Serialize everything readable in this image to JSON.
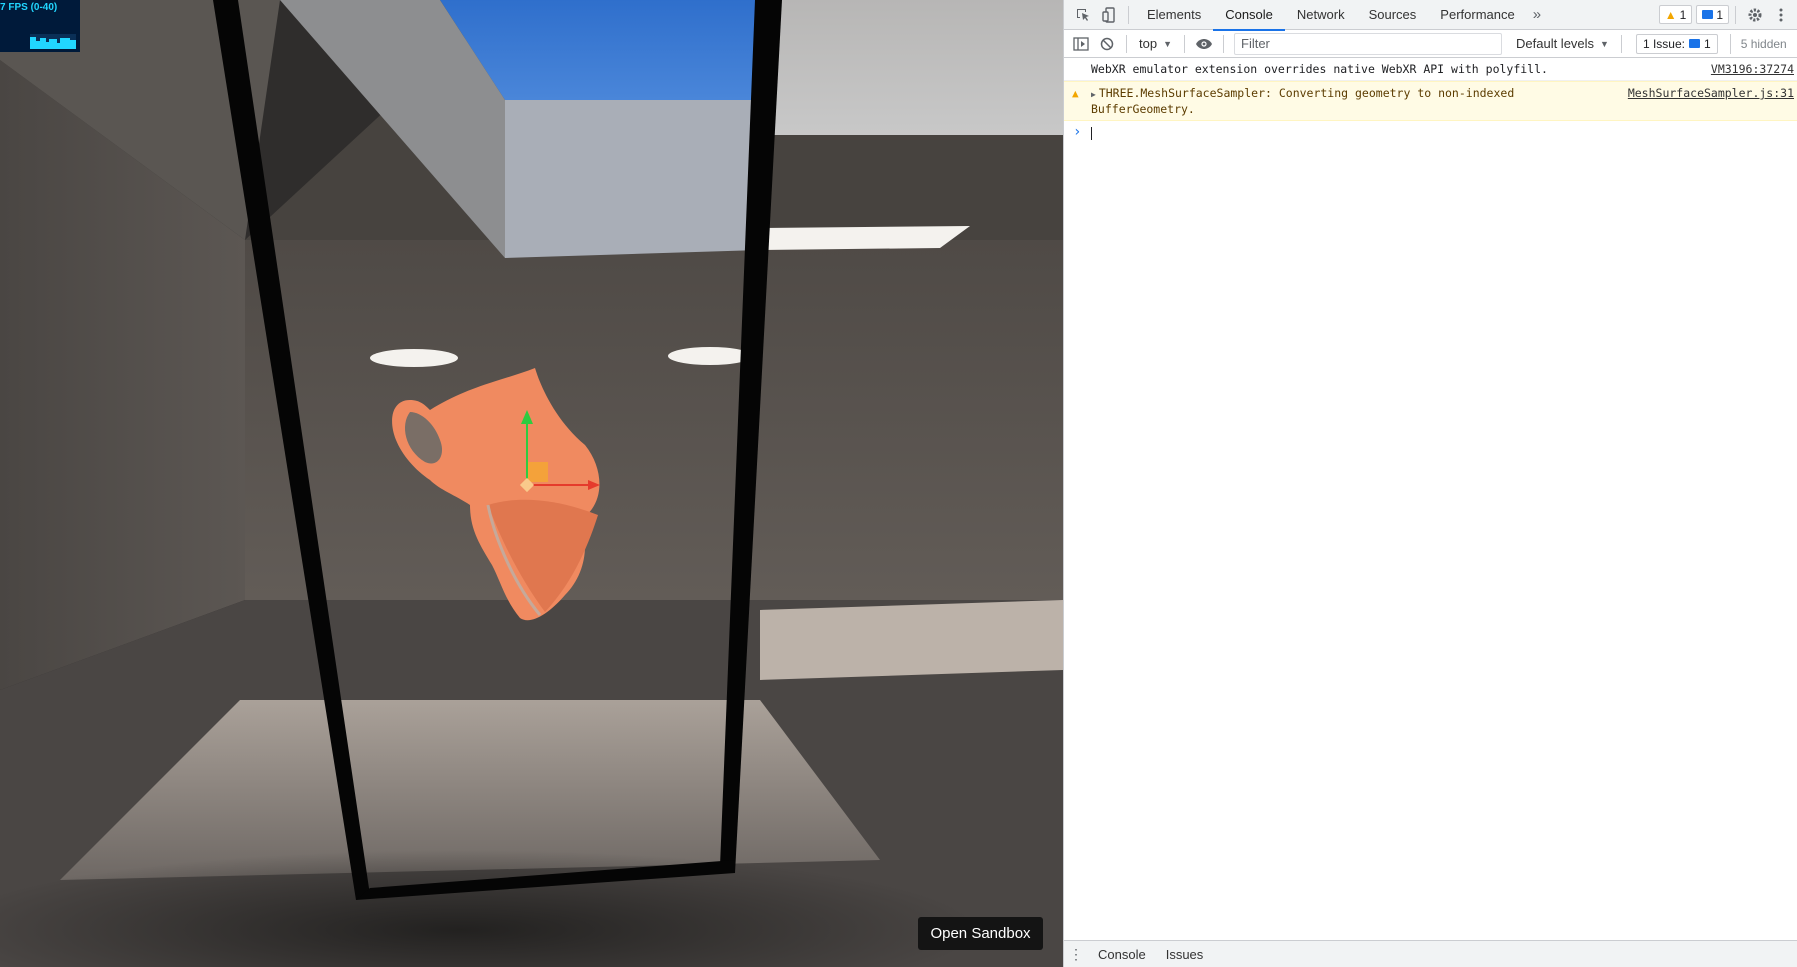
{
  "viewport": {
    "fps_label": "7 FPS (0-40)",
    "open_sandbox_label": "Open Sandbox"
  },
  "devtools": {
    "tabs": [
      "Elements",
      "Console",
      "Network",
      "Sources",
      "Performance"
    ],
    "active_tab": "Console",
    "more_tabs": "»",
    "warning_count": "1",
    "message_count": "1",
    "toolbar": {
      "context": "top",
      "filter_placeholder": "Filter",
      "levels": "Default levels",
      "issues_label": "1 Issue:",
      "issues_count": "1",
      "hidden": "5 hidden"
    },
    "messages": [
      {
        "level": "info",
        "text": "WebXR emulator extension overrides native WebXR API with polyfill.",
        "source": "VM3196:37274"
      },
      {
        "level": "warning",
        "text": "THREE.MeshSurfaceSampler: Converting geometry to non-indexed BufferGeometry.",
        "source": "MeshSurfaceSampler.js:31"
      }
    ],
    "drawer_tabs": [
      "Console",
      "Issues"
    ]
  },
  "colors": {
    "accent": "#1a73e8",
    "warning_bg": "#fffbe5",
    "vase": "#f08a60",
    "sky": "#3b78d0"
  },
  "icons": [
    "inspect-element-icon",
    "device-toolbar-icon",
    "more-tabs-icon",
    "warning-icon",
    "message-icon",
    "settings-gear-icon",
    "kebab-menu-icon",
    "sidebar-toggle-icon",
    "clear-console-icon",
    "eye-icon",
    "prompt-chevron-icon"
  ]
}
